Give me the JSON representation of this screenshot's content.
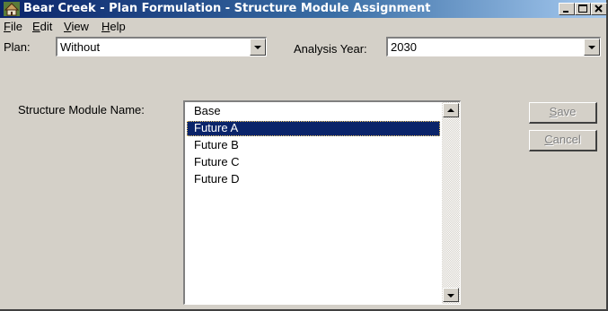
{
  "window": {
    "title": "Bear Creek - Plan Formulation - Structure Module Assignment",
    "controls": {
      "minimize": "_",
      "maximize": "□",
      "close": "×"
    }
  },
  "menu": {
    "items": [
      {
        "label_ul": "F",
        "label_rest": "ile"
      },
      {
        "label_ul": "E",
        "label_rest": "dit"
      },
      {
        "label_ul": "V",
        "label_rest": "iew"
      },
      {
        "label_ul": "H",
        "label_rest": "elp"
      }
    ]
  },
  "plan": {
    "label": "Plan:",
    "value": "Without"
  },
  "analysis_year": {
    "label": "Analysis Year:",
    "value": "2030"
  },
  "structure_module": {
    "label": "Structure Module Name:",
    "items": [
      "Base",
      "Future A",
      "Future B",
      "Future C",
      "Future D"
    ],
    "selected_index": 1
  },
  "buttons": {
    "save": {
      "label_ul": "S",
      "label_rest": "ave",
      "enabled": false
    },
    "cancel": {
      "label_ul": "C",
      "label_rest": "ancel",
      "enabled": false
    }
  },
  "colors": {
    "title_bar": "#0a246a",
    "face": "#d4d0c8",
    "selection": "#0a246a"
  }
}
